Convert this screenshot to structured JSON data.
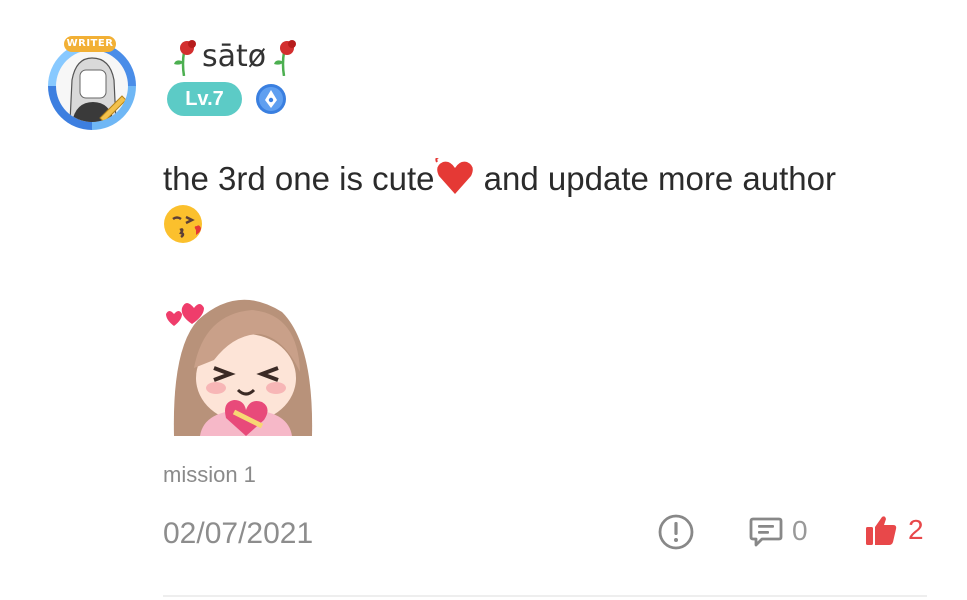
{
  "user": {
    "name": "sātø",
    "level": "Lv.7",
    "avatar_badge": "WRITER"
  },
  "comment": {
    "text_part1": "the 3rd one is cute",
    "text_part2": " and update more author",
    "sticker": "girl-holding-heart-sticker",
    "mission_label": "mission 1"
  },
  "footer": {
    "date": "02/07/2021",
    "reply_count": "0",
    "like_count": "2"
  },
  "icons": {
    "report": "alert-circle-icon",
    "comments": "comment-bubble-icon",
    "like": "thumbs-up-icon"
  },
  "colors": {
    "level_pill": "#5ccbc6",
    "like": "#e8484a",
    "muted_text": "#8d8d8d"
  }
}
